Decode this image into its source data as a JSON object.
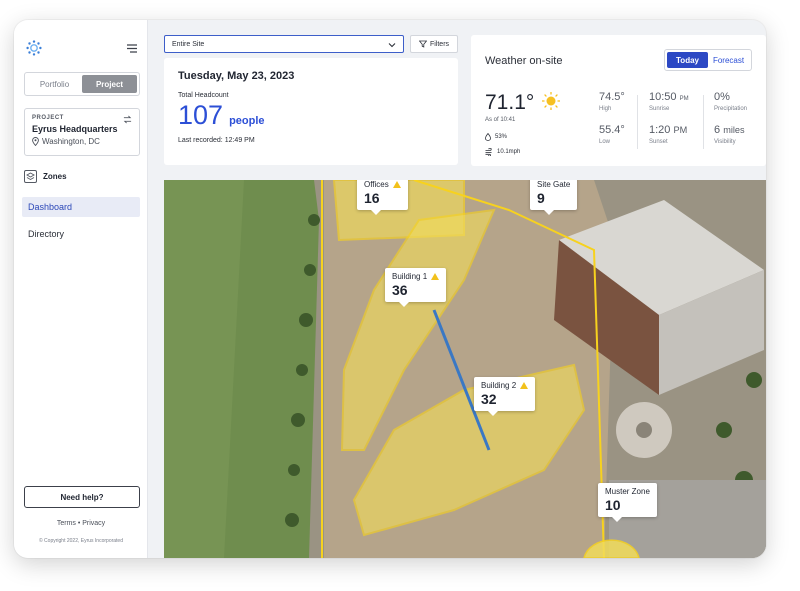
{
  "sidebar": {
    "tabs": [
      {
        "label": "Portfolio",
        "active": false
      },
      {
        "label": "Project",
        "active": true
      }
    ],
    "project": {
      "label": "PROJECT",
      "name": "Eyrus Headquarters",
      "location": "Washington, DC"
    },
    "zones_label": "Zones",
    "nav": [
      {
        "label": "Dashboard",
        "active": true
      },
      {
        "label": "Directory",
        "active": false
      }
    ],
    "help_label": "Need help?",
    "footer_links": "Terms  •  Privacy",
    "copyright": "© Copyright 2022, Eyrus Incorporated"
  },
  "toolbar": {
    "site_value": "Entire Site",
    "filters_label": "Filters"
  },
  "headcount": {
    "date": "Tuesday, May 23, 2023",
    "label": "Total Headcount",
    "count": "107",
    "unit": "people",
    "last_recorded": "Last recorded: 12:49 PM"
  },
  "weather": {
    "title": "Weather on-site",
    "toggle": [
      {
        "label": "Today",
        "active": true
      },
      {
        "label": "Forecast",
        "active": false
      }
    ],
    "temp": "71.1°",
    "as_of": "As of 10:41",
    "humidity": "53%",
    "wind": "10.1mph",
    "high": "74.5°",
    "high_label": "High",
    "low": "55.4°",
    "low_label": "Low",
    "sunrise": "10:50",
    "sunrise_unit": "PM",
    "sunrise_label": "Sunrise",
    "sunset": "1:20",
    "sunset_unit": "PM",
    "sunset_label": "Sunset",
    "precip": "0%",
    "precip_label": "Precipitation",
    "visibility": "6",
    "visibility_unit": "miles",
    "visibility_label": "Visibility"
  },
  "zones": [
    {
      "name": "Offices",
      "count": "16",
      "warning": true
    },
    {
      "name": "Site Gate",
      "count": "9",
      "warning": false
    },
    {
      "name": "Building 1",
      "count": "36",
      "warning": true
    },
    {
      "name": "Building 2",
      "count": "32",
      "warning": true
    },
    {
      "name": "Muster Zone",
      "count": "10",
      "warning": false
    }
  ],
  "colors": {
    "accent": "#2c4fd6",
    "zone_fill": "#f2dc5a",
    "zone_stroke": "#f7d21e",
    "warning": "#f2c11b"
  }
}
